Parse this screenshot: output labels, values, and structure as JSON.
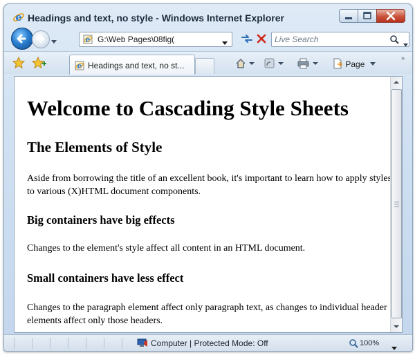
{
  "window": {
    "title": "Headings and text, no style - Windows Internet Explorer"
  },
  "address_bar": {
    "url": "G:\\Web Pages\\08fig("
  },
  "search": {
    "placeholder": "Live Search"
  },
  "tabs": [
    {
      "label": "Headings and text, no st..."
    }
  ],
  "command_bar": {
    "page_label": "Page"
  },
  "page_content": {
    "h1": "Welcome to Cascading Style Sheets",
    "h2": "The Elements of Style",
    "p1": "Aside from borrowing the title of an excellent book, it's important to learn how to apply styles to various (X)HTML document components.",
    "h3_big": "Big containers have big effects",
    "p2": "Changes to the element's style affect all content in an HTML document.",
    "h3_small": "Small containers have less effect",
    "p3": "Changes to the paragraph element affect only paragraph text, as changes to individual header elements affect only those headers."
  },
  "status_bar": {
    "zone_text": "Computer | Protected Mode: Off",
    "zoom": "100%"
  },
  "icons": [
    "ie-logo-icon",
    "back-arrow-icon",
    "forward-arrow-icon",
    "refresh-icon",
    "stop-icon",
    "search-icon",
    "favorites-star-icon",
    "add-favorites-icon",
    "home-icon",
    "feeds-icon",
    "print-icon",
    "page-icon",
    "zone-computer-icon",
    "zoom-icon"
  ]
}
